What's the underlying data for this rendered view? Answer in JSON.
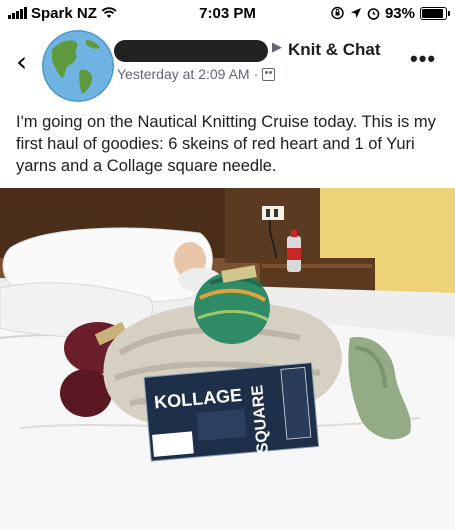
{
  "status_bar": {
    "carrier": "Spark NZ",
    "time": "7:03 PM",
    "battery_percent": "93%",
    "battery_level": 0.93
  },
  "post": {
    "group_name": "Knit & Chat",
    "timestamp": "Yesterday at 2:09 AM",
    "separator": "·",
    "text": "I'm going on the Nautical Knitting Cruise today. This is my first haul of goodies: 6 skeins of red heart and  1 of Yuri yarns and a Collage square needle."
  },
  "photo": {
    "package_brand": "KOLLAGE",
    "package_product": "SQUARE"
  },
  "icons": {
    "back": "chevron-left-icon",
    "more": "more-dots-icon",
    "wifi": "wifi-icon",
    "location": "location-arrow-icon",
    "alarm": "alarm-icon",
    "lock_rotation": "rotation-lock-icon",
    "audience": "group-audience-icon"
  },
  "colors": {
    "accent_text": "#1c1e21",
    "secondary_text": "#606770",
    "avatar_ocean": "#6fb3e3",
    "avatar_land": "#5f9a3e"
  }
}
